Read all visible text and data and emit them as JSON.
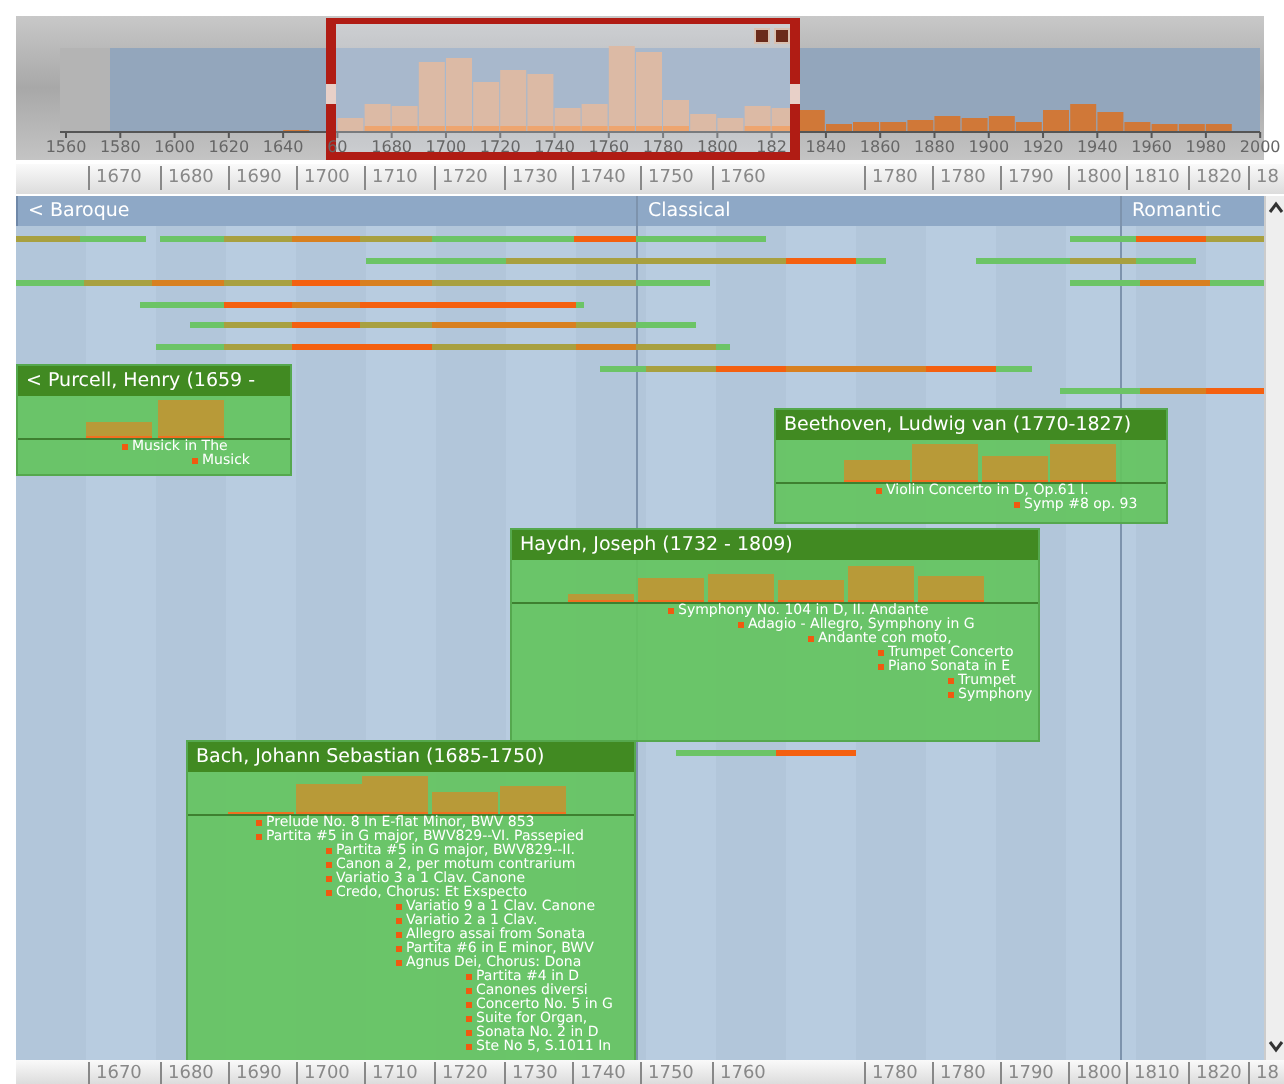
{
  "overview": {
    "axis_labels": [
      "1560",
      "1580",
      "1600",
      "1620",
      "1640",
      "60",
      "1680",
      "1700",
      "1720",
      "1740",
      "1760",
      "1780",
      "1800",
      "182",
      "1840",
      "1860",
      "1880",
      "1900",
      "1920",
      "1940",
      "1960",
      "1980",
      "2000"
    ]
  },
  "ruler_top": {
    "labels": [
      "1670",
      "1680",
      "1690",
      "1700",
      "1710",
      "1720",
      "1730",
      "1740",
      "1750",
      "1760",
      "1780",
      "1780",
      "1790",
      "1800",
      "1810",
      "1820",
      "18"
    ]
  },
  "eras": [
    {
      "label": "< Baroque"
    },
    {
      "label": "Classical"
    },
    {
      "label": "Romantic"
    }
  ],
  "composers": [
    {
      "name": "< Purcell, Henry (1659 -",
      "work_groups": [
        [
          "Musick in The"
        ],
        [
          "Musick"
        ]
      ]
    },
    {
      "name": "Beethoven, Ludwig van (1770-1827)",
      "work_groups": [
        [
          "Violin Concerto in D, Op.61 I."
        ],
        [
          "Symp #8 op. 93"
        ]
      ]
    },
    {
      "name": "Haydn, Joseph (1732 - 1809)",
      "work_groups": [
        [
          "Symphony No. 104 in D, II. Andante"
        ],
        [
          "Adagio - Allegro, Symphony in G"
        ],
        [
          "Andante con moto,"
        ],
        [
          "Trumpet Concerto",
          "Piano Sonata in E"
        ],
        [
          "Trumpet",
          "Symphony"
        ]
      ]
    },
    {
      "name": "Bach, Johann Sebastian (1685-1750)",
      "work_groups": [
        [
          "Prelude No. 8 In E-flat Minor, BWV 853",
          "Partita #5 in G major, BWV829--VI. Passepied"
        ],
        [
          "Partita #5 in G major, BWV829--II.",
          "Canon a 2, per motum contrarium",
          "Variatio 3 a 1 Clav. Canone",
          "Credo, Chorus: Et Exspecto"
        ],
        [
          "Variatio 9 a 1 Clav. Canone",
          "Variatio 2 a 1 Clav.",
          "Allegro assai from Sonata",
          "Partita #6 in E minor, BWV",
          "Agnus Dei, Chorus: Dona"
        ],
        [
          "Partita #4 in D",
          "Canones diversi",
          "Concerto No. 5 in G",
          "Suite for Organ,",
          "Sonata No. 2 in D",
          "Ste No 5, S.1011 In"
        ]
      ]
    }
  ],
  "ruler_bottom": {
    "labels": [
      "1670",
      "1680",
      "1690",
      "1700",
      "1710",
      "1720",
      "1730",
      "1740",
      "1750",
      "1760",
      "1780",
      "1780",
      "1790",
      "1800",
      "1810",
      "1820",
      "18"
    ]
  }
}
